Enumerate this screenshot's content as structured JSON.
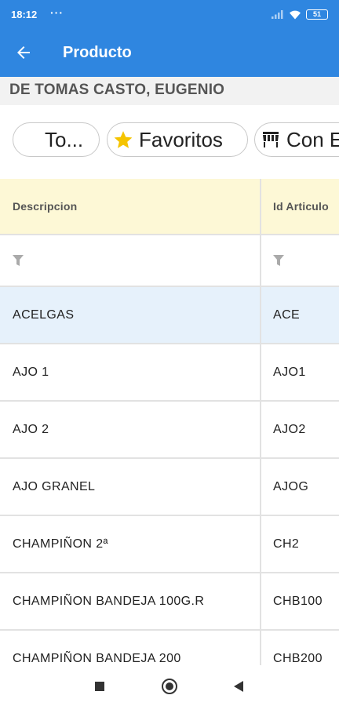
{
  "status_bar": {
    "time": "18:12",
    "dots": "···",
    "battery": "51"
  },
  "app_bar": {
    "title": "Producto",
    "back_icon": "arrow-left-icon"
  },
  "customer": {
    "name": "DE TOMAS CASTO, EUGENIO"
  },
  "filter_chips": [
    {
      "label": "To...",
      "icon": null
    },
    {
      "label": "Favoritos",
      "icon": "star-icon",
      "icon_color": "#f5c400"
    },
    {
      "label": "Con E",
      "icon": "awning-store-icon"
    }
  ],
  "table": {
    "columns": [
      "Descripcion",
      "Id Articulo"
    ],
    "filter_icon": "filter-icon",
    "selected_row_index": 0,
    "rows": [
      {
        "descripcion": "ACELGAS",
        "id": "ACE"
      },
      {
        "descripcion": "AJO 1",
        "id": "AJO1"
      },
      {
        "descripcion": "AJO 2",
        "id": "AJO2"
      },
      {
        "descripcion": "AJO GRANEL",
        "id": "AJOG"
      },
      {
        "descripcion": "CHAMPIÑON 2ª",
        "id": "CH2"
      },
      {
        "descripcion": "CHAMPIÑON BANDEJA 100G.R",
        "id": "CHB100"
      },
      {
        "descripcion": "CHAMPIÑON BANDEJA 200",
        "id": "CHB200"
      }
    ]
  },
  "colors": {
    "app_bar": "#2f86e0",
    "header_row": "#fdf8d6",
    "selected_row": "#e6f1fb"
  }
}
